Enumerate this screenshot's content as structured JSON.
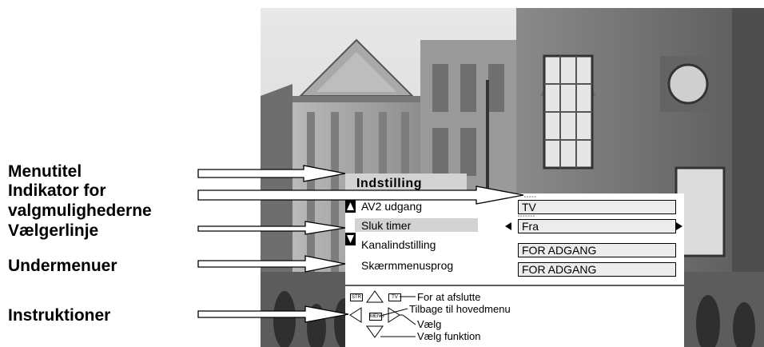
{
  "callouts": {
    "menutitel": "Menutitel",
    "indikator_line1": "Indikator for",
    "indikator_line2": "valgmulighederne",
    "vaelgerlinje": "Vælgerlinje",
    "undermenuer": "Undermenuer",
    "instruktioner": "Instruktioner"
  },
  "menu": {
    "title": "Indstilling",
    "items": [
      {
        "label": "AV2 udgang",
        "value": "TV"
      },
      {
        "label": "Sluk timer",
        "value": "Fra",
        "selected": true
      },
      {
        "label": "Kanalindstilling",
        "value": "FOR ADGANG"
      },
      {
        "label": "Skærmmenusprog",
        "value": "FOR ADGANG"
      }
    ],
    "scroll_up_icon": "up-arrow-icon",
    "scroll_down_icon": "down-arrow-icon"
  },
  "keys": {
    "str": "STR",
    "tv": "TV",
    "menu": "MENU"
  },
  "instructions": {
    "exit": "For at afslutte",
    "back": "Tilbage til hovedmenu",
    "select": "Vælg",
    "select_function": "Vælg funktion"
  },
  "colors": {
    "menu_highlight": "#d3d3d3",
    "value_box": "#ececec"
  }
}
